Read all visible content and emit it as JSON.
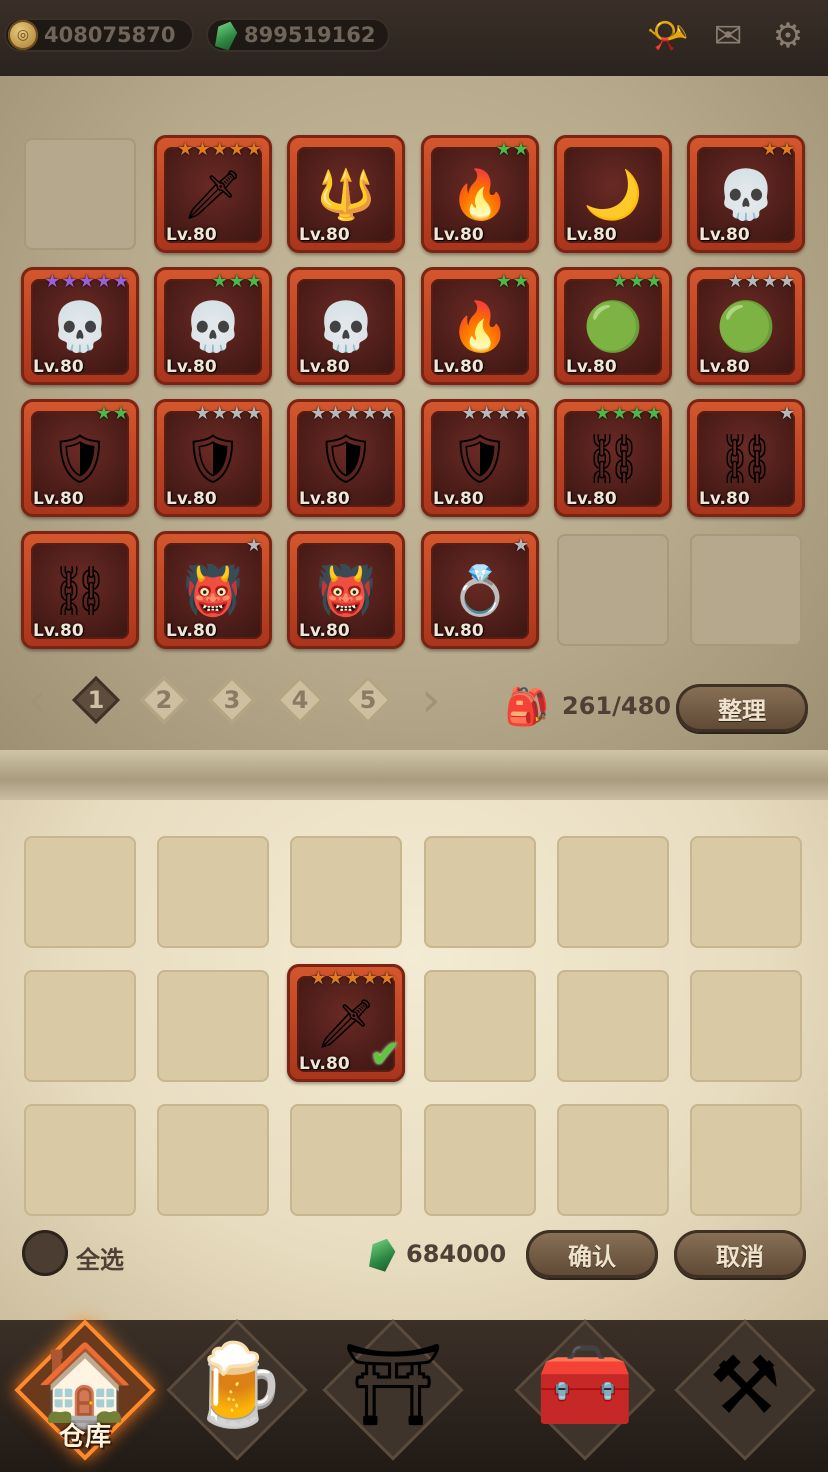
{
  "currencies": {
    "gold": {
      "icon": "gold-coin-icon",
      "value": "408075870"
    },
    "gems": {
      "icon": "green-gem-icon",
      "value": "899519162"
    }
  },
  "top_icons": [
    "horn-icon",
    "mail-icon",
    "settings-icon"
  ],
  "inventory": {
    "items": [
      {
        "icon": "curved-blade-icon",
        "level": "Lv.80",
        "stars": 5,
        "star_color": "#e07b22"
      },
      {
        "icon": "dark-staff-icon",
        "level": "Lv.80",
        "stars": 0,
        "star_color": ""
      },
      {
        "icon": "flame-spear-icon",
        "level": "Lv.80",
        "stars": 2,
        "star_color": "#4db84a"
      },
      {
        "icon": "crescent-blade-icon",
        "level": "Lv.80",
        "stars": 0,
        "star_color": ""
      },
      {
        "icon": "hooded-mask-icon",
        "level": "Lv.80",
        "stars": 2,
        "star_color": "#e07b22"
      },
      {
        "icon": "hooded-mask-icon",
        "level": "Lv.80",
        "stars": 5,
        "star_color": "#9b5fd6"
      },
      {
        "icon": "hooded-mask-icon",
        "level": "Lv.80",
        "stars": 3,
        "star_color": "#4db84a"
      },
      {
        "icon": "hooded-mask-icon",
        "level": "Lv.80",
        "stars": 0,
        "star_color": ""
      },
      {
        "icon": "flame-spear-icon",
        "level": "Lv.80",
        "stars": 2,
        "star_color": "#4db84a"
      },
      {
        "icon": "slime-flail-icon",
        "level": "Lv.80",
        "stars": 3,
        "star_color": "#4db84a"
      },
      {
        "icon": "slime-flail-icon",
        "level": "Lv.80",
        "stars": 4,
        "star_color": "#b8b8b8"
      },
      {
        "icon": "blue-armor-icon",
        "level": "Lv.80",
        "stars": 2,
        "star_color": "#4db84a"
      },
      {
        "icon": "blue-armor-icon",
        "level": "Lv.80",
        "stars": 4,
        "star_color": "#b8b8b8"
      },
      {
        "icon": "purple-armor-icon",
        "level": "Lv.80",
        "stars": 5,
        "star_color": "#b8b8b8"
      },
      {
        "icon": "purple-armor-icon",
        "level": "Lv.80",
        "stars": 4,
        "star_color": "#b8b8b8"
      },
      {
        "icon": "chained-gauntlet-icon",
        "level": "Lv.80",
        "stars": 4,
        "star_color": "#4db84a"
      },
      {
        "icon": "chained-gauntlet-icon",
        "level": "Lv.80",
        "stars": 1,
        "star_color": "#b8b8b8"
      },
      {
        "icon": "chained-gauntlet-icon",
        "level": "Lv.80",
        "stars": 0,
        "star_color": ""
      },
      {
        "icon": "demon-helmet-icon",
        "level": "Lv.80",
        "stars": 1,
        "star_color": "#b8b8b8"
      },
      {
        "icon": "demon-helmet-icon",
        "level": "Lv.80",
        "stars": 0,
        "star_color": ""
      },
      {
        "icon": "flame-ring-icon",
        "level": "Lv.80",
        "stars": 1,
        "star_color": "#b8b8b8"
      }
    ]
  },
  "pagination": {
    "pages": [
      "1",
      "2",
      "3",
      "4",
      "5"
    ],
    "current_page": "1",
    "capacity": "261/480",
    "sort_label": "整理"
  },
  "selection": {
    "selected_item": {
      "icon": "curved-blade-icon",
      "level": "Lv.80",
      "stars": 5,
      "star_color": "#e07b22"
    },
    "select_all_label": "全选",
    "total_value": "684000",
    "confirm_label": "确认",
    "cancel_label": "取消"
  },
  "nav": {
    "items": [
      {
        "icon": "warehouse-icon",
        "label": "仓库",
        "active": true
      },
      {
        "icon": "tavern-mug-icon",
        "label": "",
        "active": false
      },
      {
        "icon": "portal-gate-icon",
        "label": "",
        "active": false
      },
      {
        "icon": "treasure-chest-icon",
        "label": "",
        "active": false
      },
      {
        "icon": "forge-cauldron-icon",
        "label": "",
        "active": false
      }
    ]
  }
}
